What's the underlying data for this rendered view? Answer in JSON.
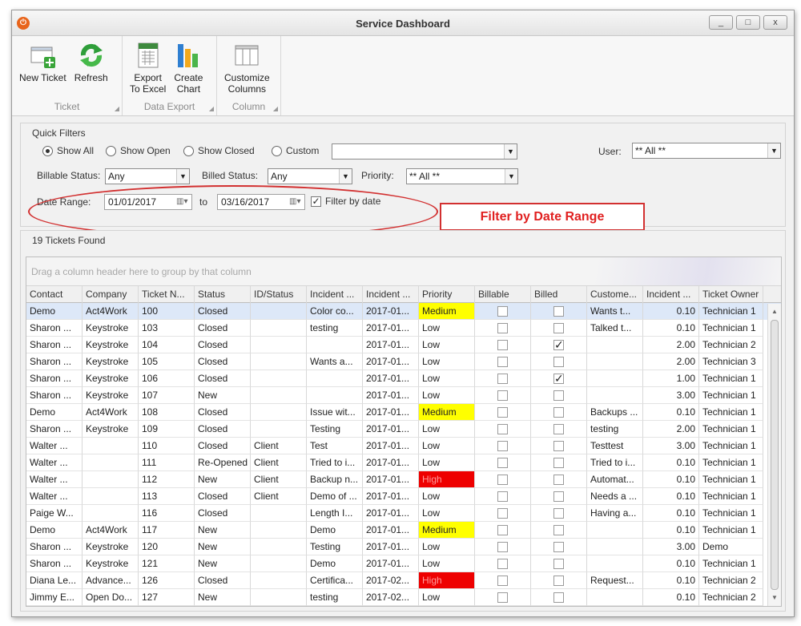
{
  "window": {
    "title": "Service Dashboard",
    "controls": {
      "minimize": "_",
      "maximize": "□",
      "close": "x"
    },
    "app_icon": "power-icon"
  },
  "ribbon": {
    "groups": [
      {
        "label": "Ticket",
        "buttons": [
          {
            "label": "New Ticket",
            "icon": "new-ticket-icon"
          },
          {
            "label": "Refresh",
            "icon": "refresh-icon"
          }
        ]
      },
      {
        "label": "Data Export",
        "buttons": [
          {
            "label": "Export\nTo Excel",
            "icon": "excel-icon"
          },
          {
            "label": "Create\nChart",
            "icon": "bar-chart-icon"
          }
        ]
      },
      {
        "label": "Column",
        "buttons": [
          {
            "label": "Customize\nColumns",
            "icon": "columns-icon"
          }
        ]
      }
    ]
  },
  "filters": {
    "legend": "Quick Filters",
    "radios": [
      {
        "label": "Show All",
        "checked": true
      },
      {
        "label": "Show Open",
        "checked": false
      },
      {
        "label": "Show Closed",
        "checked": false
      },
      {
        "label": "Custom",
        "checked": false
      }
    ],
    "custom_value": "",
    "user_label": "User:",
    "user_value": "** All **",
    "billable_label": "Billable Status:",
    "billable_value": "Any",
    "billed_label": "Billed Status:",
    "billed_value": "Any",
    "priority_label": "Priority:",
    "priority_value": "** All **",
    "date_range_label": "Date Range:",
    "date_from": "01/01/2017",
    "to_label": "to",
    "date_to": "03/16/2017",
    "filter_by_date_label": "Filter by date",
    "filter_by_date_checked": true
  },
  "annotation": {
    "callout": "Filter by Date Range",
    "color": "#d23030"
  },
  "grid": {
    "found_label": "19 Tickets Found",
    "group_hint": "Drag a column header here to group by that column",
    "columns": [
      "Contact",
      "Company",
      "Ticket N...",
      "Status",
      "ID/Status",
      "Incident ...",
      "Incident ...",
      "Priority",
      "Billable",
      "Billed",
      "Custome...",
      "Incident ...",
      "Ticket Owner"
    ],
    "rows": [
      {
        "contact": "Demo",
        "company": "Act4Work",
        "ticket": "100",
        "status": "Closed",
        "idstatus": "",
        "incident": "Color co...",
        "date": "2017-01...",
        "priority": "Medium",
        "billable": false,
        "billed": false,
        "customer": "Wants t...",
        "hours": "0.10",
        "owner": "Technician 1"
      },
      {
        "contact": "Sharon ...",
        "company": "Keystroke",
        "ticket": "103",
        "status": "Closed",
        "idstatus": "",
        "incident": "testing",
        "date": "2017-01...",
        "priority": "Low",
        "billable": false,
        "billed": false,
        "customer": "Talked t...",
        "hours": "0.10",
        "owner": "Technician 1"
      },
      {
        "contact": "Sharon ...",
        "company": "Keystroke",
        "ticket": "104",
        "status": "Closed",
        "idstatus": "",
        "incident": "",
        "date": "2017-01...",
        "priority": "Low",
        "billable": false,
        "billed": true,
        "customer": "",
        "hours": "2.00",
        "owner": "Technician 2"
      },
      {
        "contact": "Sharon ...",
        "company": "Keystroke",
        "ticket": "105",
        "status": "Closed",
        "idstatus": "",
        "incident": "Wants a...",
        "date": "2017-01...",
        "priority": "Low",
        "billable": false,
        "billed": false,
        "customer": "",
        "hours": "2.00",
        "owner": "Technician 3"
      },
      {
        "contact": "Sharon ...",
        "company": "Keystroke",
        "ticket": "106",
        "status": "Closed",
        "idstatus": "",
        "incident": "",
        "date": "2017-01...",
        "priority": "Low",
        "billable": false,
        "billed": true,
        "customer": "",
        "hours": "1.00",
        "owner": "Technician 1"
      },
      {
        "contact": "Sharon ...",
        "company": "Keystroke",
        "ticket": "107",
        "status": "New",
        "idstatus": "",
        "incident": "",
        "date": "2017-01...",
        "priority": "Low",
        "billable": false,
        "billed": false,
        "customer": "",
        "hours": "3.00",
        "owner": "Technician 1"
      },
      {
        "contact": "Demo",
        "company": "Act4Work",
        "ticket": "108",
        "status": "Closed",
        "idstatus": "",
        "incident": "Issue wit...",
        "date": "2017-01...",
        "priority": "Medium",
        "billable": false,
        "billed": false,
        "customer": "Backups ...",
        "hours": "0.10",
        "owner": "Technician 1"
      },
      {
        "contact": "Sharon ...",
        "company": "Keystroke",
        "ticket": "109",
        "status": "Closed",
        "idstatus": "",
        "incident": "Testing",
        "date": "2017-01...",
        "priority": "Low",
        "billable": false,
        "billed": false,
        "customer": "testing",
        "hours": "2.00",
        "owner": "Technician 1"
      },
      {
        "contact": "Walter ...",
        "company": "",
        "ticket": "110",
        "status": "Closed",
        "idstatus": "Client",
        "incident": "Test",
        "date": "2017-01...",
        "priority": "Low",
        "billable": false,
        "billed": false,
        "customer": "Testtest",
        "hours": "3.00",
        "owner": "Technician 1"
      },
      {
        "contact": "Walter ...",
        "company": "",
        "ticket": "111",
        "status": "Re-Opened",
        "idstatus": "Client",
        "incident": "Tried to i...",
        "date": "2017-01...",
        "priority": "Low",
        "billable": false,
        "billed": false,
        "customer": "Tried to i...",
        "hours": "0.10",
        "owner": "Technician 1"
      },
      {
        "contact": "Walter ...",
        "company": "",
        "ticket": "112",
        "status": "New",
        "idstatus": "Client",
        "incident": "Backup n...",
        "date": "2017-01...",
        "priority": "High",
        "billable": false,
        "billed": false,
        "customer": "Automat...",
        "hours": "0.10",
        "owner": "Technician 1"
      },
      {
        "contact": "Walter ...",
        "company": "",
        "ticket": "113",
        "status": "Closed",
        "idstatus": "Client",
        "incident": "Demo of ...",
        "date": "2017-01...",
        "priority": "Low",
        "billable": false,
        "billed": false,
        "customer": "Needs a ...",
        "hours": "0.10",
        "owner": "Technician 1"
      },
      {
        "contact": "Paige W...",
        "company": "",
        "ticket": "116",
        "status": "Closed",
        "idstatus": "",
        "incident": "Length I...",
        "date": "2017-01...",
        "priority": "Low",
        "billable": false,
        "billed": false,
        "customer": "Having a...",
        "hours": "0.10",
        "owner": "Technician 1"
      },
      {
        "contact": "Demo",
        "company": "Act4Work",
        "ticket": "117",
        "status": "New",
        "idstatus": "",
        "incident": "Demo",
        "date": "2017-01...",
        "priority": "Medium",
        "billable": false,
        "billed": false,
        "customer": "",
        "hours": "0.10",
        "owner": "Technician 1"
      },
      {
        "contact": "Sharon ...",
        "company": "Keystroke",
        "ticket": "120",
        "status": "New",
        "idstatus": "",
        "incident": "Testing",
        "date": "2017-01...",
        "priority": "Low",
        "billable": false,
        "billed": false,
        "customer": "",
        "hours": "3.00",
        "owner": "Demo"
      },
      {
        "contact": "Sharon ...",
        "company": "Keystroke",
        "ticket": "121",
        "status": "New",
        "idstatus": "",
        "incident": "Demo",
        "date": "2017-01...",
        "priority": "Low",
        "billable": false,
        "billed": false,
        "customer": "",
        "hours": "0.10",
        "owner": "Technician 1"
      },
      {
        "contact": "Diana Le...",
        "company": "Advance...",
        "ticket": "126",
        "status": "Closed",
        "idstatus": "",
        "incident": "Certifica...",
        "date": "2017-02...",
        "priority": "High",
        "billable": false,
        "billed": false,
        "customer": "Request...",
        "hours": "0.10",
        "owner": "Technician 2"
      },
      {
        "contact": "Jimmy E...",
        "company": "Open Do...",
        "ticket": "127",
        "status": "New",
        "idstatus": "",
        "incident": "testing",
        "date": "2017-02...",
        "priority": "Low",
        "billable": false,
        "billed": false,
        "customer": "",
        "hours": "0.10",
        "owner": "Technician 2"
      }
    ],
    "selected_row": 0,
    "priority_colors": {
      "Medium": "#ffff00",
      "High": "#ee0000"
    }
  }
}
